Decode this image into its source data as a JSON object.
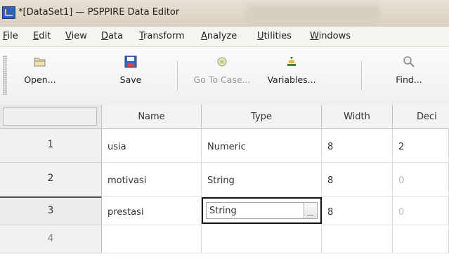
{
  "window": {
    "title": "*[DataSet1] — PSPPIRE Data Editor",
    "app_icon": "psppire-app-icon"
  },
  "menu": [
    {
      "label": "File",
      "mnemonic": "F"
    },
    {
      "label": "Edit",
      "mnemonic": "E"
    },
    {
      "label": "View",
      "mnemonic": "V"
    },
    {
      "label": "Data",
      "mnemonic": "D"
    },
    {
      "label": "Transform",
      "mnemonic": "T"
    },
    {
      "label": "Analyze",
      "mnemonic": "A"
    },
    {
      "label": "Utilities",
      "mnemonic": "U"
    },
    {
      "label": "Windows",
      "mnemonic": "W"
    }
  ],
  "toolbar": {
    "open": {
      "label": "Open...",
      "icon": "folder-open-icon"
    },
    "save": {
      "label": "Save",
      "icon": "floppy-disk-icon"
    },
    "goto_case": {
      "label": "Go To Case...",
      "icon": "goto-case-icon",
      "enabled": false
    },
    "variables": {
      "label": "Variables...",
      "icon": "variables-icon"
    },
    "find": {
      "label": "Find...",
      "icon": "magnifier-icon"
    }
  },
  "grid": {
    "columns": [
      "Name",
      "Type",
      "Width",
      "Deci"
    ],
    "rows": [
      {
        "num": "1",
        "name": "usia",
        "type": "Numeric",
        "width": "8",
        "decimals": "2"
      },
      {
        "num": "2",
        "name": "motivasi",
        "type": "String",
        "width": "8",
        "decimals": "0"
      },
      {
        "num": "3",
        "name": "prestasi",
        "type": "String",
        "width": "8",
        "decimals": "0"
      },
      {
        "num": "4",
        "name": "",
        "type": "",
        "width": "",
        "decimals": ""
      }
    ],
    "active_cell": {
      "row": 3,
      "column": "Type",
      "value": "String"
    }
  },
  "colors": {
    "titlebar": "#e0d8ca",
    "grid_header": "#f3f3f3",
    "active_border": "#111111",
    "disabled_text": "#9a9a9a"
  }
}
